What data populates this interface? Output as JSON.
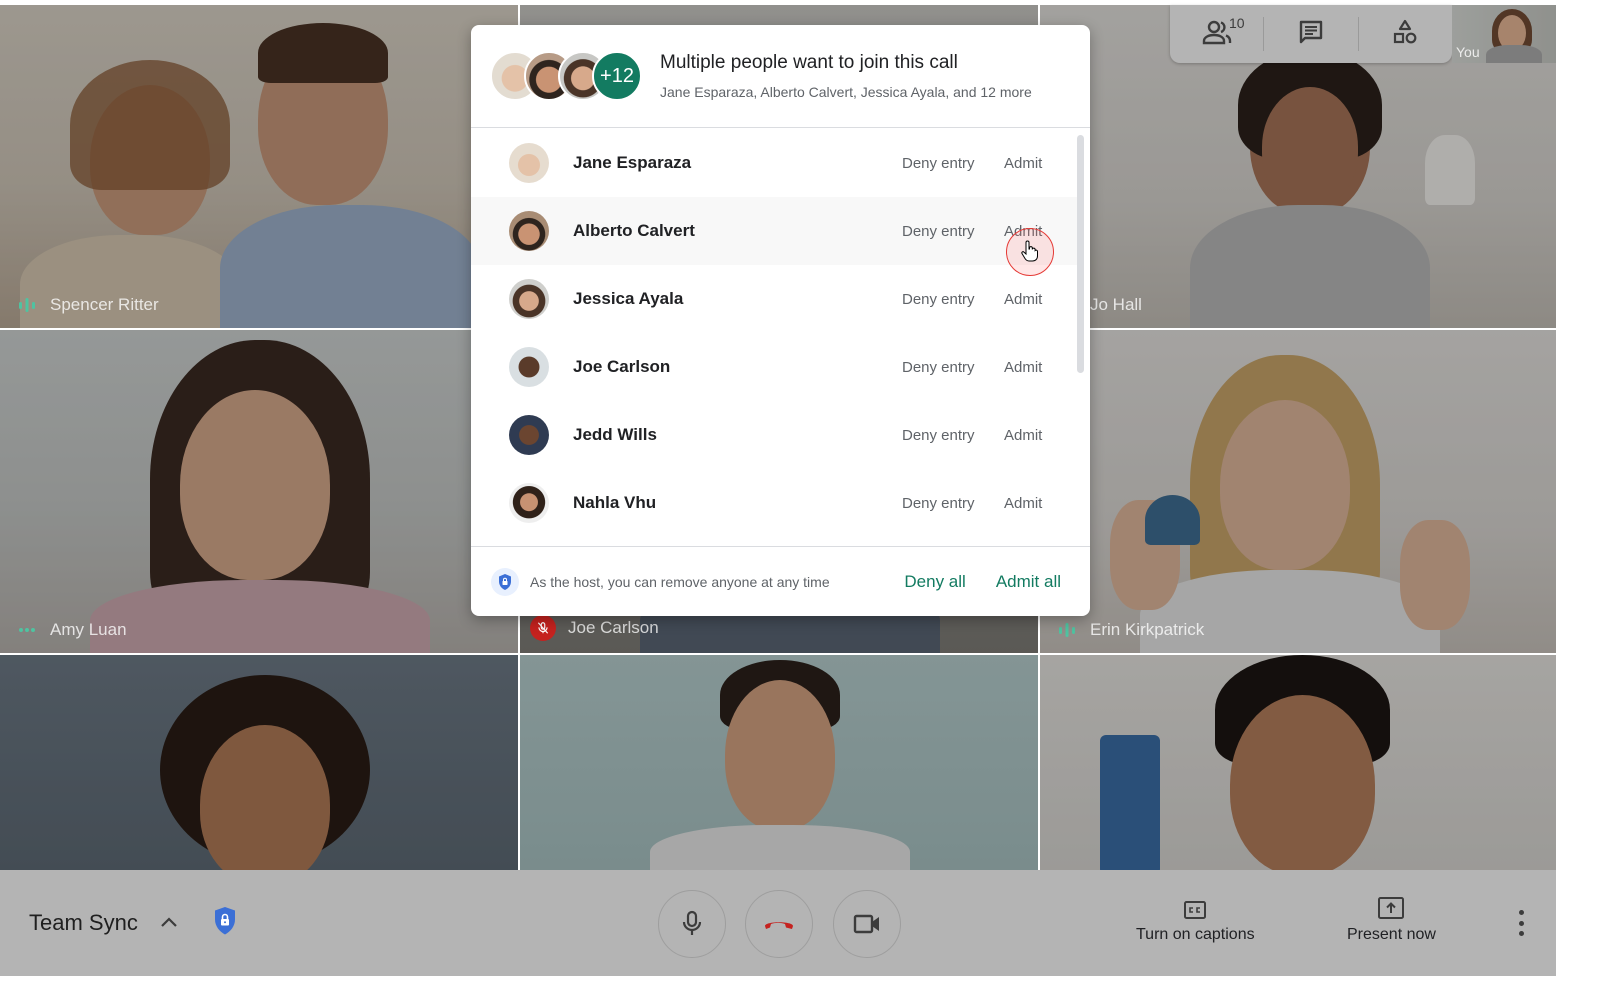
{
  "meeting": {
    "title": "Team Sync"
  },
  "top_toolbar": {
    "participants_icon": "people-icon",
    "participant_count": "10",
    "chat_icon": "chat-icon",
    "activities_icon": "shapes-icon"
  },
  "self_view": {
    "label": "You"
  },
  "tiles": [
    {
      "name": "Spencer Ritter",
      "status": "speaking",
      "indicator_icon": "audio-bars-icon"
    },
    {
      "name": "Jo Hall",
      "status": "none"
    },
    {
      "name": "Amy Luan",
      "status": "connecting",
      "indicator_icon": "dots-icon"
    },
    {
      "name": "Joe Carlson",
      "status": "muted",
      "indicator_icon": "mic-off-icon"
    },
    {
      "name": "Erin Kirkpatrick",
      "status": "speaking",
      "indicator_icon": "audio-bars-icon"
    },
    {
      "name": "",
      "status": "none"
    },
    {
      "name": "",
      "status": "none"
    },
    {
      "name": "",
      "status": "none"
    }
  ],
  "dialog": {
    "title": "Multiple people want to join this call",
    "subtitle": "Jane Esparaza, Alberto Calvert, Jessica Ayala, and 12 more",
    "more_count": "+12",
    "requests": [
      {
        "name": "Jane Esparaza",
        "deny_label": "Deny entry",
        "admit_label": "Admit"
      },
      {
        "name": "Alberto Calvert",
        "deny_label": "Deny entry",
        "admit_label": "Admit"
      },
      {
        "name": "Jessica Ayala",
        "deny_label": "Deny entry",
        "admit_label": "Admit"
      },
      {
        "name": "Joe Carlson",
        "deny_label": "Deny entry",
        "admit_label": "Admit"
      },
      {
        "name": "Jedd Wills",
        "deny_label": "Deny entry",
        "admit_label": "Admit"
      },
      {
        "name": "Nahla Vhu",
        "deny_label": "Deny entry",
        "admit_label": "Admit"
      }
    ],
    "footer_note": "As the host, you can remove anyone at any time",
    "deny_all_label": "Deny all",
    "admit_all_label": "Admit all"
  },
  "bottom_bar": {
    "mic_icon": "microphone-icon",
    "hangup_icon": "hang-up-icon",
    "camera_icon": "video-camera-icon",
    "captions_label": "Turn on captions",
    "present_label": "Present now",
    "more_icon": "more-vert-icon"
  },
  "colors": {
    "accent_green": "#137b61",
    "speaking_green": "#4fc3a1",
    "hangup_red": "#c5221f",
    "shield_blue": "#3b6fd6",
    "bar_gray": "#b4b4b4"
  }
}
